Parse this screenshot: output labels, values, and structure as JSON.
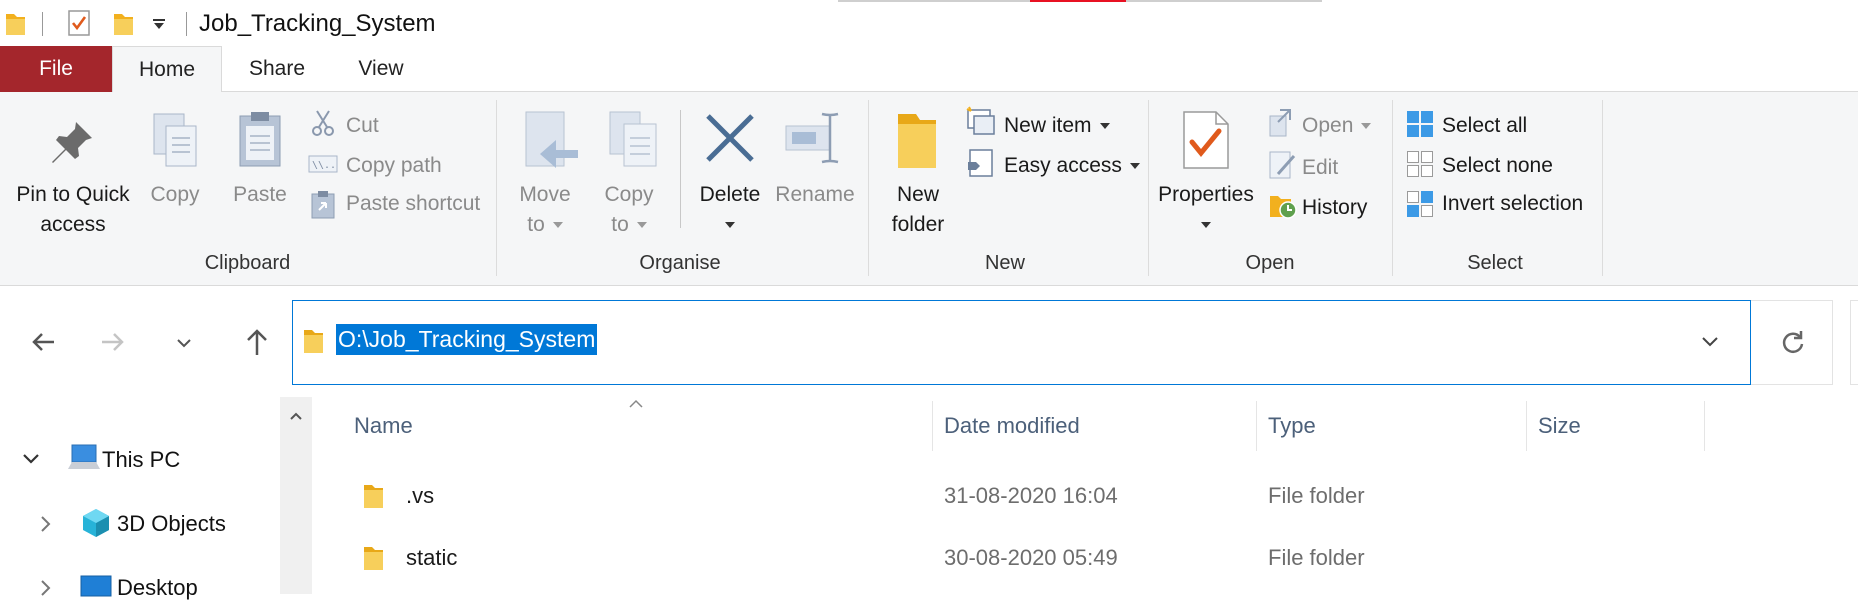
{
  "window": {
    "title": "Job_Tracking_System"
  },
  "tabs": {
    "file": "File",
    "home": "Home",
    "share": "Share",
    "view": "View"
  },
  "ribbon": {
    "clipboard": {
      "group_label": "Clipboard",
      "pin_line1": "Pin to Quick",
      "pin_line2": "access",
      "copy": "Copy",
      "paste": "Paste",
      "cut": "Cut",
      "copy_path": "Copy path",
      "paste_shortcut": "Paste shortcut"
    },
    "organise": {
      "group_label": "Organise",
      "move_line1": "Move",
      "move_line2": "to",
      "copy_line1": "Copy",
      "copy_line2": "to",
      "delete": "Delete",
      "rename": "Rename"
    },
    "new": {
      "group_label": "New",
      "new_folder_line1": "New",
      "new_folder_line2": "folder",
      "new_item": "New item",
      "easy_access": "Easy access"
    },
    "open": {
      "group_label": "Open",
      "properties": "Properties",
      "open": "Open",
      "edit": "Edit",
      "history": "History"
    },
    "select": {
      "group_label": "Select",
      "select_all": "Select all",
      "select_none": "Select none",
      "invert_selection": "Invert selection"
    }
  },
  "address": {
    "path": "O:\\Job_Tracking_System"
  },
  "nav_tree": {
    "items": [
      {
        "label": "This PC",
        "icon": "computer-icon",
        "expanded": true
      },
      {
        "label": "3D Objects",
        "icon": "cube-3d-icon",
        "expanded": false
      },
      {
        "label": "Desktop",
        "icon": "desktop-icon",
        "expanded": false
      }
    ]
  },
  "file_list": {
    "columns": [
      "Name",
      "Date modified",
      "Type",
      "Size"
    ],
    "sort_indicator": "ascending",
    "rows": [
      {
        "name": ".vs",
        "date": "31-08-2020 16:04",
        "type": "File folder",
        "size": ""
      },
      {
        "name": "static",
        "date": "30-08-2020 05:49",
        "type": "File folder",
        "size": ""
      }
    ]
  },
  "colors": {
    "file_tab": "#a4262c",
    "accent": "#0078d7",
    "folder": "#f7c948",
    "ribbon_bg": "#f5f6f7"
  }
}
